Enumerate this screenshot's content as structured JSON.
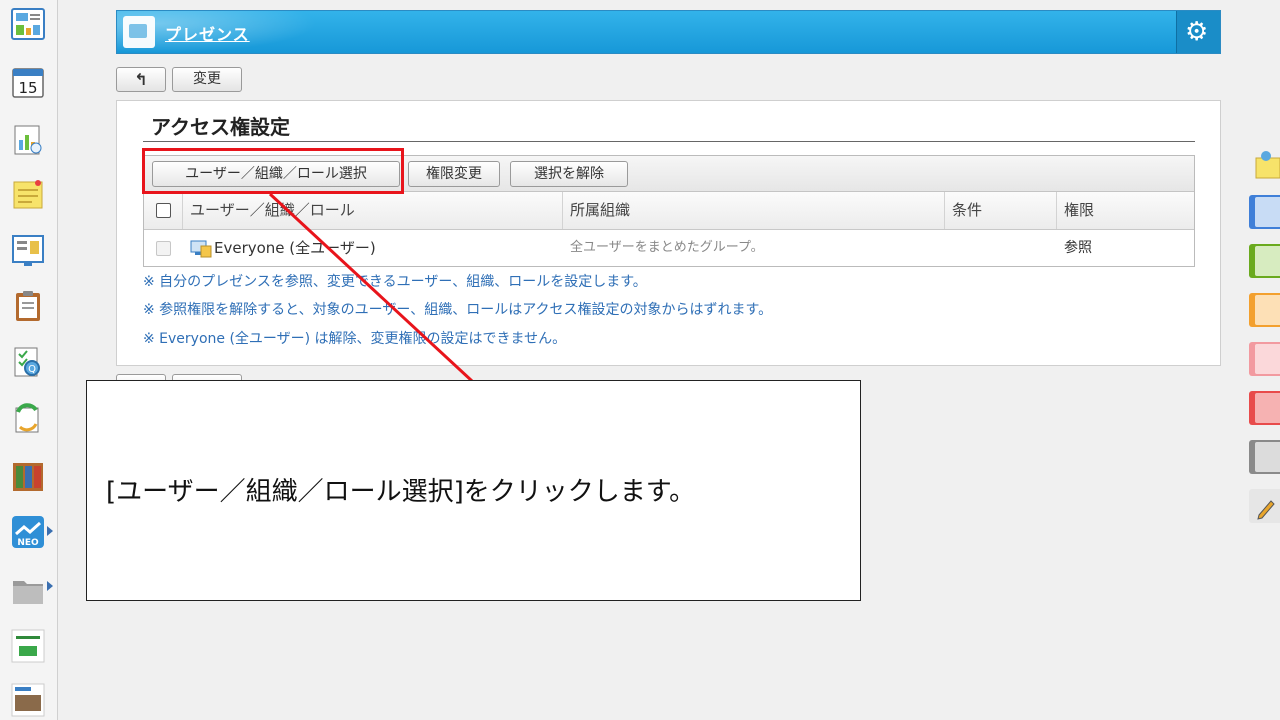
{
  "header": {
    "title": "プレゼンス",
    "settings_icon": "gear-icon"
  },
  "toolbar": {
    "back_icon": "back-arrow-icon",
    "change_label": "変更"
  },
  "panel": {
    "title": "アクセス権設定",
    "buttons": {
      "select": "ユーザー／組織／ロール選択",
      "permission": "権限変更",
      "clear": "選択を解除"
    },
    "columns": [
      "ユーザー／組織／ロール",
      "所属組織",
      "条件",
      "権限"
    ],
    "rows": [
      {
        "name": "Everyone (全ユーザー)",
        "org": "全ユーザーをまとめたグループ。",
        "condition": "",
        "permission": "参照"
      }
    ],
    "notes": [
      "※ 自分のプレゼンスを参照、変更できるユーザー、組織、ロールを設定します。",
      "※ 参照権限を解除すると、対象のユーザー、組織、ロールはアクセス権設定の対象からはずれます。",
      "※ Everyone (全ユーザー) は解除、変更権限の設定はできません。"
    ]
  },
  "callout": {
    "text": "[ユーザー／組織／ロール選択]をクリックします。"
  },
  "sidebar_apps": [
    "portal-icon",
    "calendar-icon",
    "report-icon",
    "memo-icon",
    "bulletin-icon",
    "clipboard-icon",
    "search-doc-icon",
    "refresh-doc-icon",
    "binder-icon",
    "neo-icon",
    "folder-icon",
    "tanomail-icon",
    "photo-icon"
  ],
  "calendar_day": "15",
  "neo_label": "NEO",
  "colors": {
    "banner": "#1798d8",
    "accent_red": "#e8141b",
    "note_blue": "#2f6fb6",
    "tags": [
      "#3f7fd8",
      "#6aaa1e",
      "#f3a02e",
      "#f29aa0",
      "#e84b4b",
      "#8a8a8a"
    ]
  }
}
